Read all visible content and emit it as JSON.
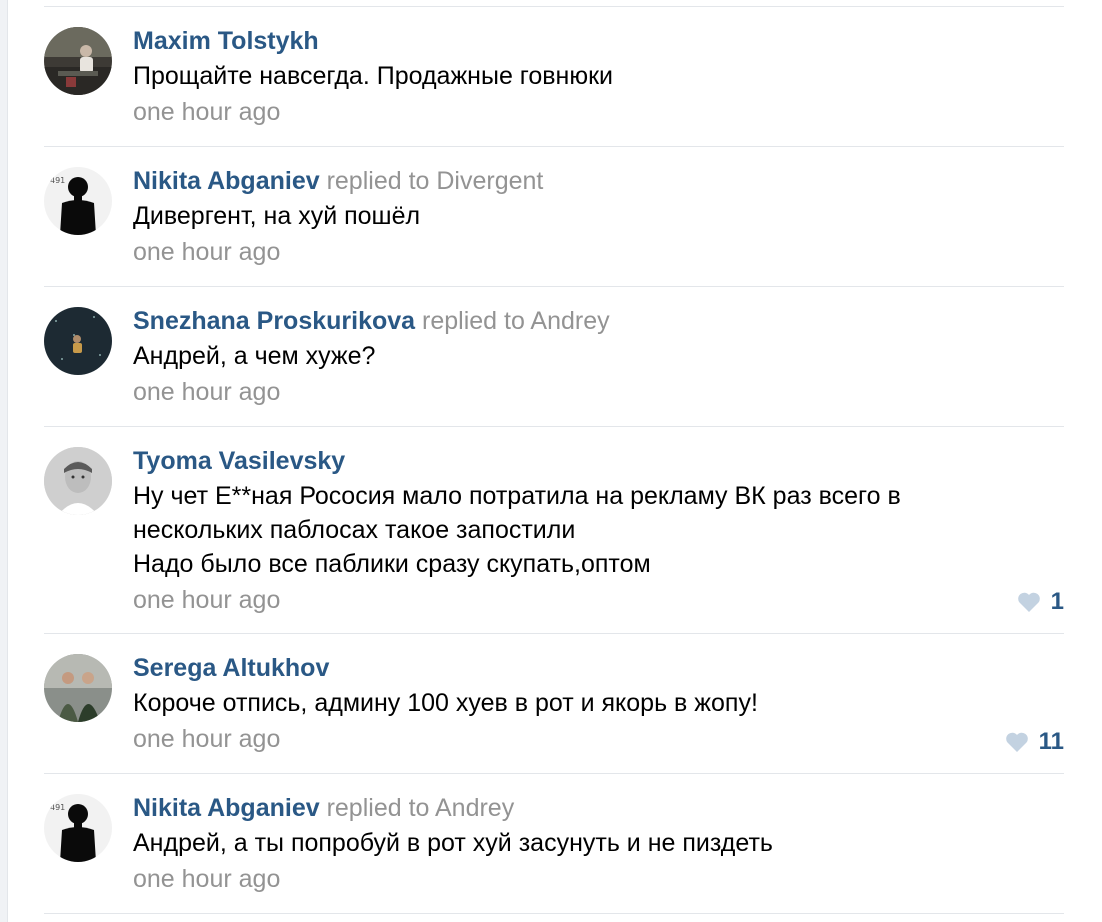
{
  "theme": {
    "author_color": "#2a5885",
    "meta_color": "#939393",
    "like_icon_color": "#c3d2e1"
  },
  "comments": [
    {
      "author": "Maxim Tolstykh",
      "replied_to": "",
      "lines": [
        "Прощайте навсегда. Продажные говнюки"
      ],
      "time": "one hour ago",
      "likes": "",
      "avatar": "avatar-photo"
    },
    {
      "author": "Nikita Abganiev",
      "replied_to": "replied to Divergent",
      "lines": [
        "Дивергент, на хуй пошёл"
      ],
      "time": "one hour ago",
      "likes": "",
      "avatar": "avatar-silhouette"
    },
    {
      "author": "Snezhana Proskurikova",
      "replied_to": "replied to Andrey",
      "lines": [
        "Андрей, а чем хуже?"
      ],
      "time": "one hour ago",
      "likes": "",
      "avatar": "avatar-photo"
    },
    {
      "author": "Tyoma Vasilevsky",
      "replied_to": "",
      "lines": [
        "Ну чет Е**ная Росoсия мало потратила на рекламу ВК раз всего в",
        "нескольких паблосах такое запостили",
        "Надо было все паблики сразу скупать,оптом"
      ],
      "time": "one hour ago",
      "likes": "1",
      "avatar": "avatar-photo"
    },
    {
      "author": "Serega Altukhov",
      "replied_to": "",
      "lines": [
        "Короче отпись, админу 100 хуев в рот и якорь в жопу!"
      ],
      "time": "one hour ago",
      "likes": "11",
      "avatar": "avatar-photo"
    },
    {
      "author": "Nikita Abganiev",
      "replied_to": "replied to Andrey",
      "lines": [
        "Андрей, а ты попробуй в рот хуй засунуть и не пиздеть"
      ],
      "time": "one hour ago",
      "likes": "",
      "avatar": "avatar-silhouette"
    }
  ]
}
